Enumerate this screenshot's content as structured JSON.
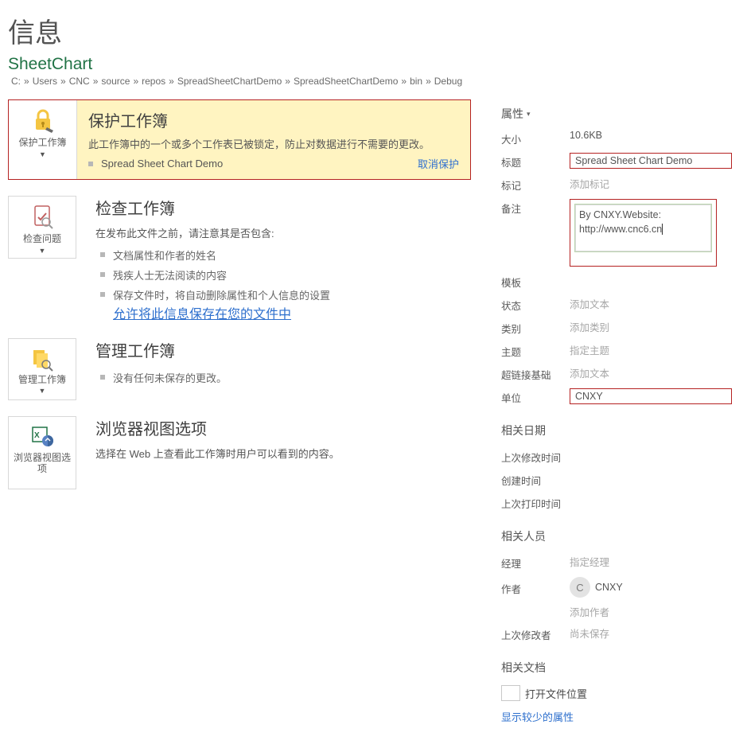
{
  "pageTitle": "信息",
  "docName": "SheetChart",
  "breadcrumb": [
    "C:",
    "Users",
    "CNC",
    "source",
    "repos",
    "SpreadSheetChartDemo",
    "SpreadSheetChartDemo",
    "bin",
    "Debug"
  ],
  "breadcrumbSep": "»",
  "protect": {
    "btnLabel": "保护工作簿",
    "title": "保护工作簿",
    "desc": "此工作簿中的一个或多个工作表已被锁定，防止对数据进行不需要的更改。",
    "lockedSheet": "Spread Sheet Chart Demo",
    "unprotect": "取消保护"
  },
  "inspect": {
    "btnLabel": "检查问题",
    "title": "检查工作簿",
    "desc": "在发布此文件之前，请注意其是否包含:",
    "bullets": [
      "文档属性和作者的姓名",
      "残疾人士无法阅读的内容",
      "保存文件时，将自动删除属性和个人信息的设置"
    ],
    "allowLink": "允许将此信息保存在您的文件中"
  },
  "manage": {
    "btnLabel": "管理工作簿",
    "title": "管理工作簿",
    "bullets": [
      "没有任何未保存的更改。"
    ]
  },
  "browserView": {
    "btnLabel": "浏览器视图选项",
    "title": "浏览器视图选项",
    "desc": "选择在 Web 上查看此工作簿时用户可以看到的内容。"
  },
  "props": {
    "heading": "属性",
    "rows": {
      "size": {
        "label": "大小",
        "value": "10.6KB"
      },
      "title": {
        "label": "标题",
        "value": "Spread Sheet Chart Demo"
      },
      "tags": {
        "label": "标记",
        "placeholder": "添加标记"
      },
      "comments": {
        "label": "备注",
        "value": "By CNXY.Website: http://www.cnc6.cn"
      },
      "template": {
        "label": "模板",
        "value": ""
      },
      "status": {
        "label": "状态",
        "placeholder": "添加文本"
      },
      "category": {
        "label": "类别",
        "placeholder": "添加类别"
      },
      "subject": {
        "label": "主题",
        "placeholder": "指定主题"
      },
      "hyperlinkBase": {
        "label": "超链接基础",
        "placeholder": "添加文本"
      },
      "company": {
        "label": "单位",
        "value": "CNXY"
      }
    },
    "datesHeading": "相关日期",
    "dates": {
      "modified": {
        "label": "上次修改时间",
        "value": ""
      },
      "created": {
        "label": "创建时间",
        "value": ""
      },
      "printed": {
        "label": "上次打印时间",
        "value": ""
      }
    },
    "peopleHeading": "相关人员",
    "people": {
      "manager": {
        "label": "经理",
        "placeholder": "指定经理"
      },
      "author": {
        "label": "作者",
        "name": "CNXY",
        "initial": "C"
      },
      "addAuthor": "添加作者",
      "lastModifiedBy": {
        "label": "上次修改者",
        "placeholder": "尚未保存"
      }
    },
    "docsHeading": "相关文档",
    "openLocation": "打开文件位置",
    "showLess": "显示较少的属性"
  }
}
